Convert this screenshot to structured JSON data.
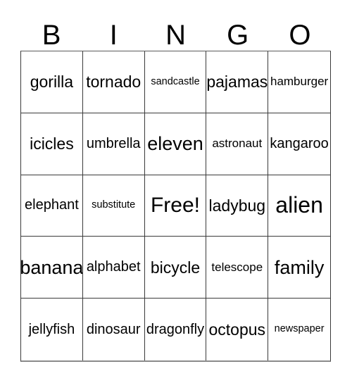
{
  "card": {
    "headers": [
      "B",
      "I",
      "N",
      "G",
      "O"
    ],
    "rows": [
      [
        {
          "text": "gorilla",
          "size_class": "len-7"
        },
        {
          "text": "tornado",
          "size_class": "len-7"
        },
        {
          "text": "sandcastle",
          "size_class": "len-10"
        },
        {
          "text": "pajamas",
          "size_class": "len-7"
        },
        {
          "text": "hamburger",
          "size_class": "len-9"
        }
      ],
      [
        {
          "text": "icicles",
          "size_class": "len-7"
        },
        {
          "text": "umbrella",
          "size_class": "len-8"
        },
        {
          "text": "eleven",
          "size_class": "len-6"
        },
        {
          "text": "astronaut",
          "size_class": "len-9"
        },
        {
          "text": "kangaroo",
          "size_class": "len-8"
        }
      ],
      [
        {
          "text": "elephant",
          "size_class": "len-8"
        },
        {
          "text": "substitute",
          "size_class": "len-10"
        },
        {
          "text": "Free!",
          "size_class": "len-free"
        },
        {
          "text": "ladybug",
          "size_class": "len-7"
        },
        {
          "text": "alien",
          "size_class": "len-5"
        }
      ],
      [
        {
          "text": "banana",
          "size_class": "len-6"
        },
        {
          "text": "alphabet",
          "size_class": "len-8"
        },
        {
          "text": "bicycle",
          "size_class": "len-7"
        },
        {
          "text": "telescope",
          "size_class": "len-9"
        },
        {
          "text": "family",
          "size_class": "len-6"
        }
      ],
      [
        {
          "text": "jellyfish",
          "size_class": "len-8"
        },
        {
          "text": "dinosaur",
          "size_class": "len-8"
        },
        {
          "text": "dragonfly",
          "size_class": "len-8"
        },
        {
          "text": "octopus",
          "size_class": "len-7"
        },
        {
          "text": "newspaper",
          "size_class": "len-10"
        }
      ]
    ]
  },
  "colors": {
    "background": "#ffffff",
    "text": "#000000",
    "grid_line": "#3a3a3a",
    "grid_bottom": "#8a8a8a"
  }
}
